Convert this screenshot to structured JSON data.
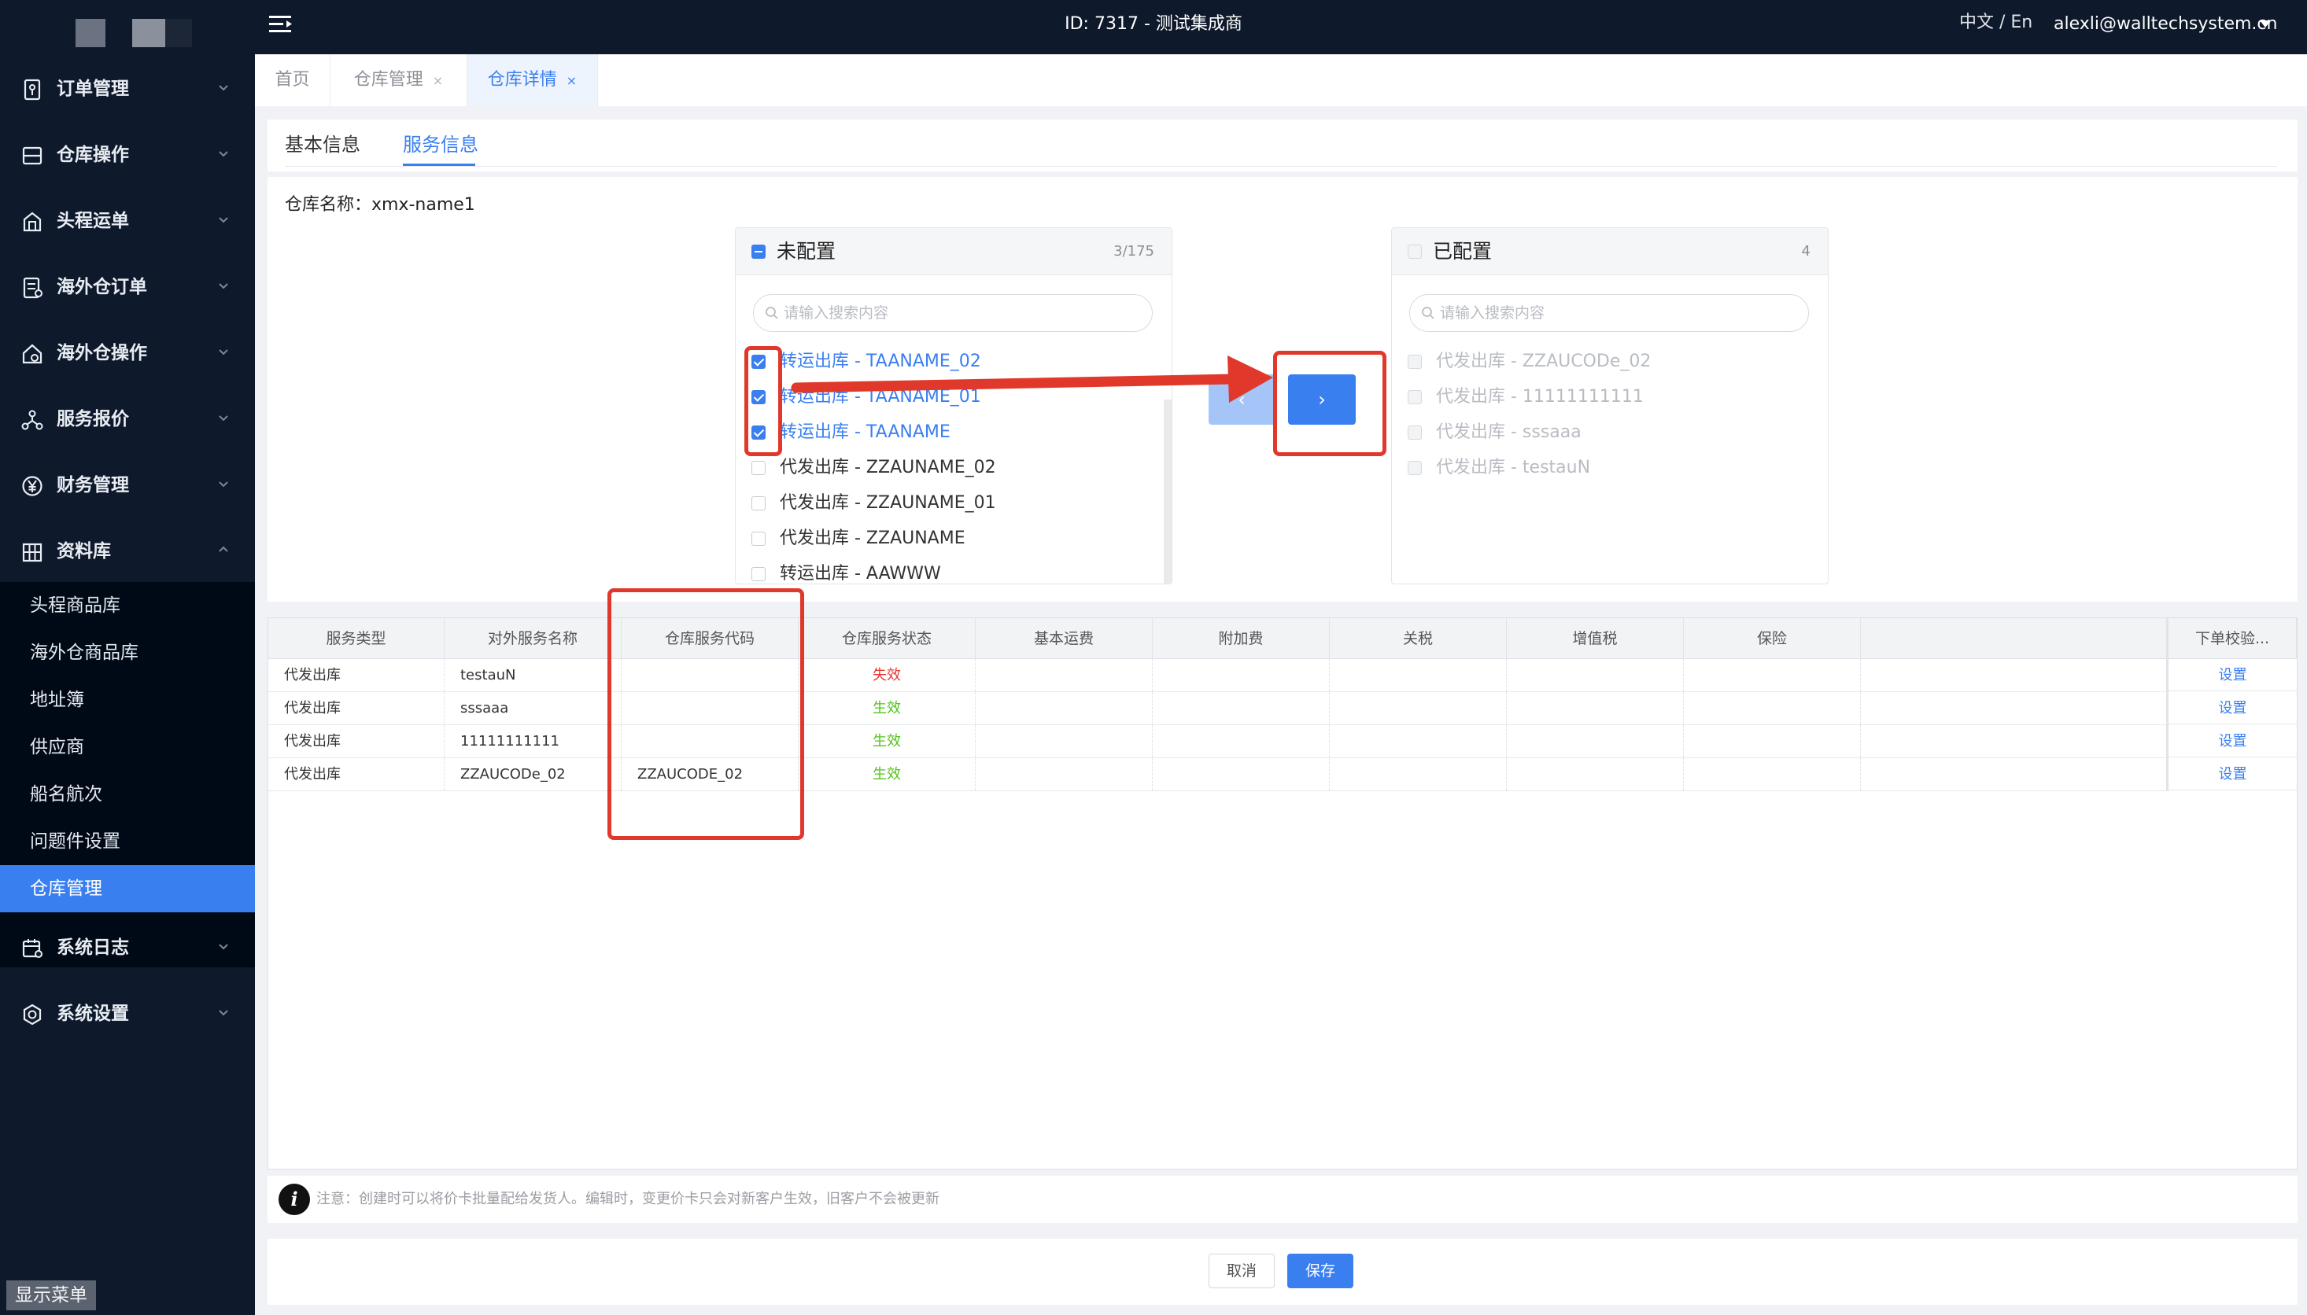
{
  "header": {
    "center_title": "ID: 7317 - 测试集成商",
    "lang_switch": "中文 / En",
    "user_email": "alexli@walltechsystem.cn"
  },
  "sidebar": {
    "items": [
      {
        "label": "订单管理",
        "icon": "order-icon"
      },
      {
        "label": "仓库操作",
        "icon": "warehouse-icon"
      },
      {
        "label": "头程运单",
        "icon": "shipment-icon"
      },
      {
        "label": "海外仓订单",
        "icon": "document-icon"
      },
      {
        "label": "海外仓操作",
        "icon": "home-gear-icon"
      },
      {
        "label": "服务报价",
        "icon": "network-icon"
      },
      {
        "label": "财务管理",
        "icon": "yen-icon"
      },
      {
        "label": "资料库",
        "icon": "building-icon"
      },
      {
        "label": "系统日志",
        "icon": "calendar-icon"
      },
      {
        "label": "系统设置",
        "icon": "settings-icon"
      }
    ],
    "sub_items": [
      {
        "label": "头程商品库"
      },
      {
        "label": "海外仓商品库"
      },
      {
        "label": "地址簿"
      },
      {
        "label": "供应商"
      },
      {
        "label": "船名航次"
      },
      {
        "label": "问题件设置"
      },
      {
        "label": "仓库管理"
      }
    ],
    "active_sub": "仓库管理",
    "show_menu": "显示菜单"
  },
  "tabs": [
    {
      "label": "首页",
      "active": false
    },
    {
      "label": "仓库管理",
      "active": false
    },
    {
      "label": "仓库详情",
      "active": true
    }
  ],
  "subtabs": {
    "basic": "基本信息",
    "service": "服务信息",
    "active": "服务信息"
  },
  "warehouse_name": "仓库名称：xmx-name1",
  "transfer": {
    "left": {
      "title": "未配置",
      "count": "3/175",
      "search_placeholder": "请输入搜索内容",
      "items": [
        {
          "label": "转运出库 - TAANAME_02",
          "checked": true
        },
        {
          "label": "转运出库 - TAANAME_01",
          "checked": true
        },
        {
          "label": "转运出库 - TAANAME",
          "checked": true
        },
        {
          "label": "代发出库 - ZZAUNAME_02",
          "checked": false
        },
        {
          "label": "代发出库 - ZZAUNAME_01",
          "checked": false
        },
        {
          "label": "代发出库 - ZZAUNAME",
          "checked": false
        },
        {
          "label": "转运出库 - AAWWW",
          "checked": false
        }
      ]
    },
    "right": {
      "title": "已配置",
      "count": "4",
      "search_placeholder": "请输入搜索内容",
      "items": [
        {
          "label": "代发出库 - ZZAUCODe_02"
        },
        {
          "label": "代发出库 - 11111111111"
        },
        {
          "label": "代发出库 - sssaaa"
        },
        {
          "label": "代发出库 - testauN"
        }
      ]
    },
    "btn_left": "‹",
    "btn_right": "›"
  },
  "table": {
    "columns": [
      "服务类型",
      "对外服务名称",
      "仓库服务代码",
      "仓库服务状态",
      "基本运费",
      "附加费",
      "关税",
      "增值税",
      "保险",
      "下单校验..."
    ],
    "rows": [
      {
        "type": "代发出库",
        "name": "testauN",
        "code": "",
        "status": "失效",
        "action": "设置"
      },
      {
        "type": "代发出库",
        "name": "sssaaa",
        "code": "",
        "status": "生效",
        "action": "设置"
      },
      {
        "type": "代发出库",
        "name": "11111111111",
        "code": "",
        "status": "生效",
        "action": "设置"
      },
      {
        "type": "代发出库",
        "name": "ZZAUCODe_02",
        "code": "ZZAUCODE_02",
        "status": "生效",
        "action": "设置"
      }
    ]
  },
  "notice": "注意：创建时可以将价卡批量配给发货人。编辑时，变更价卡只会对新客户生效，旧客户不会被更新",
  "footer": {
    "cancel": "取消",
    "save": "保存"
  },
  "colors": {
    "primary": "#3a7ff0",
    "nav_bg": "#0e1a2b",
    "annotation": "#e0392b",
    "status_invalid": "#e53935",
    "status_valid": "#52c41a"
  }
}
